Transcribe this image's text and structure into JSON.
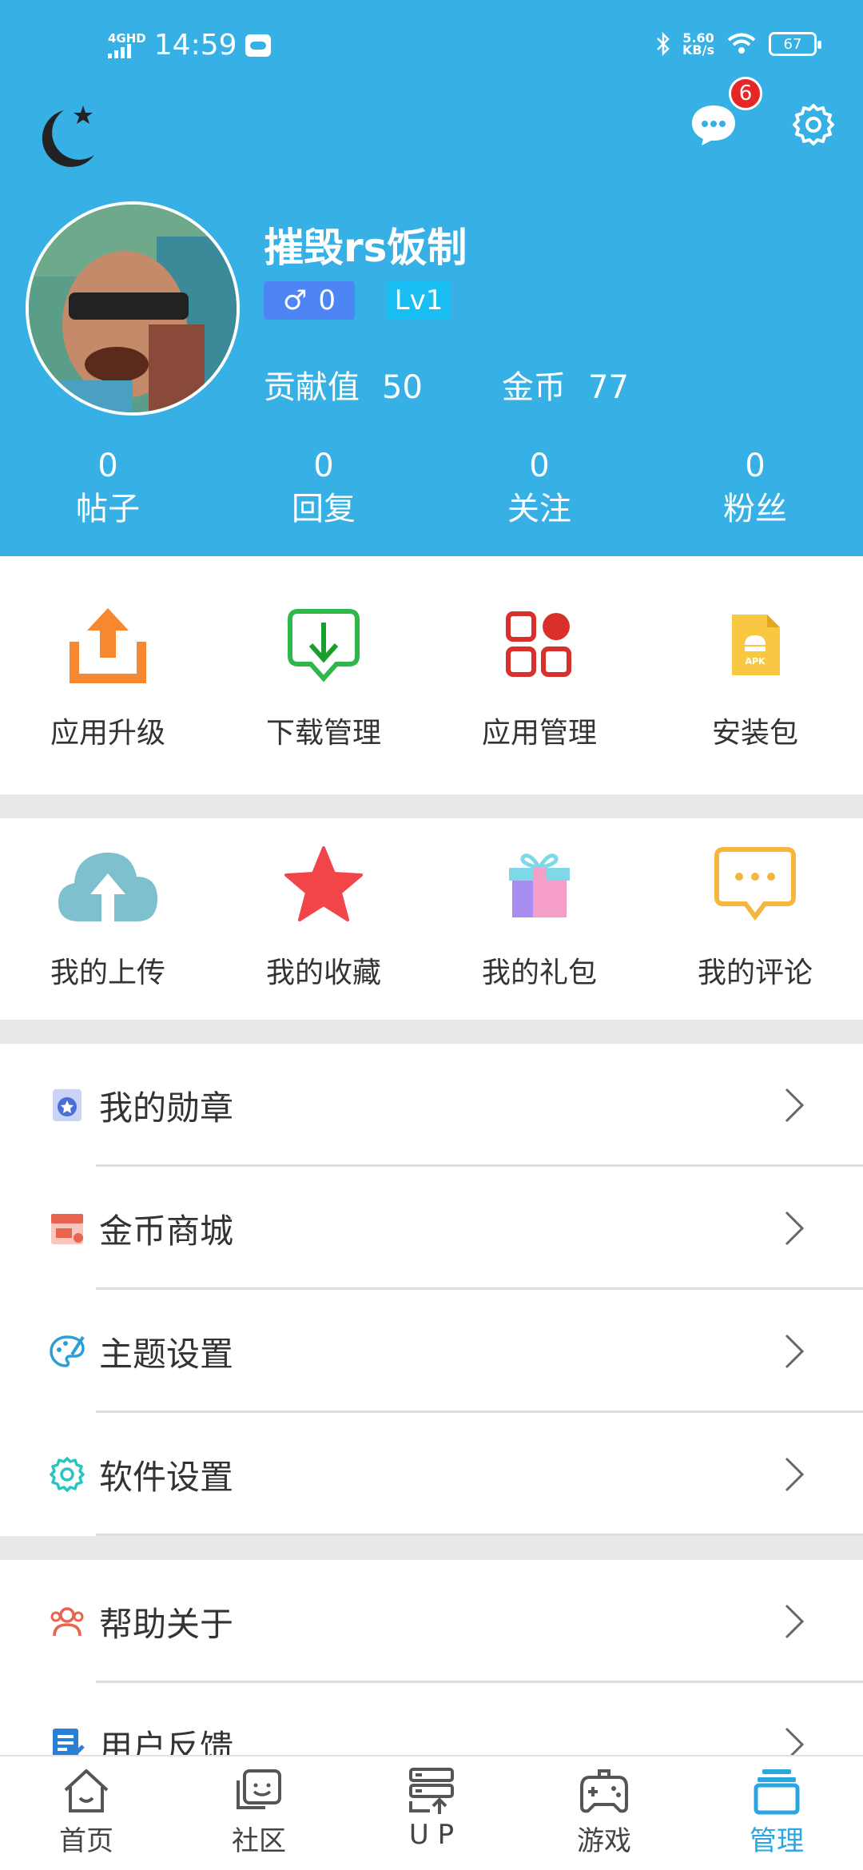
{
  "status_bar": {
    "network": "4G",
    "network_sup": "HD",
    "time": "14:59",
    "speed_value": "5.60",
    "speed_unit": "KB/s",
    "battery": "67"
  },
  "profile": {
    "username": "摧毁rs饭制",
    "gender_symbol": "♂",
    "gender_count": "0",
    "level": "Lv1",
    "contribution_label": "贡献值",
    "contribution_value": "50",
    "coins_label": "金币",
    "coins_value": "77",
    "message_badge": "6"
  },
  "counts": [
    {
      "value": "0",
      "label": "帖子"
    },
    {
      "value": "0",
      "label": "回复"
    },
    {
      "value": "0",
      "label": "关注"
    },
    {
      "value": "0",
      "label": "粉丝"
    }
  ],
  "tools": [
    {
      "label": "应用升级",
      "icon": "upload-tray-icon"
    },
    {
      "label": "下载管理",
      "icon": "download-icon"
    },
    {
      "label": "应用管理",
      "icon": "apps-grid-icon"
    },
    {
      "label": "安装包",
      "icon": "apk-file-icon"
    }
  ],
  "mine": [
    {
      "label": "我的上传",
      "icon": "cloud-upload-icon"
    },
    {
      "label": "我的收藏",
      "icon": "star-icon"
    },
    {
      "label": "我的礼包",
      "icon": "gift-icon"
    },
    {
      "label": "我的评论",
      "icon": "comment-icon"
    }
  ],
  "menu": [
    {
      "label": "我的勋章",
      "icon": "medal-icon",
      "color": "#4a6fd6"
    },
    {
      "label": "金币商城",
      "icon": "shop-icon",
      "color": "#e8644f"
    },
    {
      "label": "主题设置",
      "icon": "palette-icon",
      "color": "#2a9fd6"
    },
    {
      "label": "软件设置",
      "icon": "settings-icon",
      "color": "#26c6c0"
    }
  ],
  "menu2": [
    {
      "label": "帮助关于",
      "icon": "help-users-icon",
      "color": "#e8644f"
    },
    {
      "label": "用户反馈",
      "icon": "feedback-icon",
      "color": "#2a7fd6"
    }
  ],
  "nav": [
    {
      "label": "首页",
      "icon": "home-icon"
    },
    {
      "label": "社区",
      "icon": "community-icon"
    },
    {
      "label": "U P",
      "icon": "up-server-icon"
    },
    {
      "label": "游戏",
      "icon": "gamepad-icon"
    },
    {
      "label": "管理",
      "icon": "manage-icon",
      "active": true
    }
  ],
  "colors": {
    "header": "#36b0e5",
    "accent": "#2aa7e1",
    "badge": "#e52727"
  }
}
